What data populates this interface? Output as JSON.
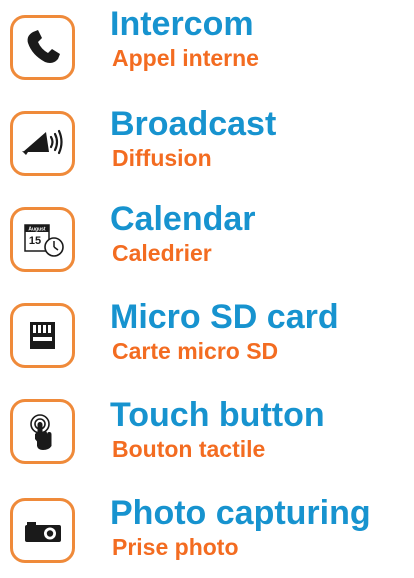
{
  "colors": {
    "title": "#1793cf",
    "subtitle": "#f36c21",
    "icon_border": "#ef8a3a",
    "icon_fill": "#1a1a1a"
  },
  "features": [
    {
      "title": "Intercom",
      "subtitle": "Appel interne",
      "icon": "phone-handset-icon"
    },
    {
      "title": "Broadcast",
      "subtitle": "Diffusion",
      "icon": "megaphone-icon"
    },
    {
      "title": "Calendar",
      "subtitle": "Caledrier",
      "icon": "calendar-clock-icon",
      "icon_text": [
        "August",
        "15"
      ]
    },
    {
      "title": "Micro SD card",
      "subtitle": "Carte micro SD",
      "icon": "micro-sd-card-icon"
    },
    {
      "title": "Touch button",
      "subtitle": "Bouton tactile",
      "icon": "touch-finger-icon"
    },
    {
      "title": "Photo capturing",
      "subtitle": "Prise photo",
      "icon": "camera-icon"
    }
  ]
}
